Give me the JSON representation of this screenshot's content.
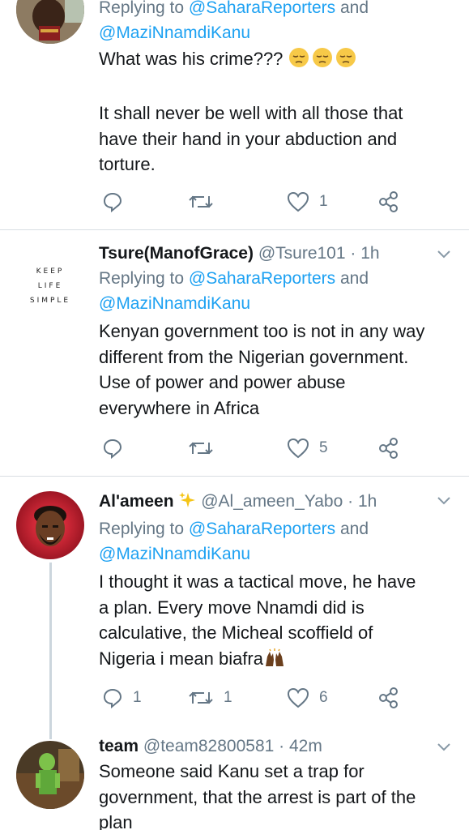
{
  "tweets": [
    {
      "reply_prefix": "Replying to",
      "reply_mention1": "@SaharaReporters",
      "reply_and": "and",
      "reply_mention2": "@MaziNnamdiKanu",
      "text_line1": "What was his crime???",
      "text_rest": "It shall never be well with all those that\nhave their hand in your abduction and\ntorture.",
      "emoji": "pensive-face x3",
      "actions": {
        "reply": "",
        "retweet": "",
        "like": "1"
      }
    },
    {
      "name": "Tsure(ManofGrace)",
      "handle": "@Tsure101",
      "sep": "·",
      "time": "1h",
      "reply_prefix": "Replying to",
      "reply_mention1": "@SaharaReporters",
      "reply_and": "and",
      "reply_mention2": "@MaziNnamdiKanu",
      "avatar_text": [
        "KEEP",
        "LIFE",
        "SIMPLE"
      ],
      "text": "Kenyan government too is not in any way\ndifferent from the Nigerian government.\nUse of power and power abuse\neverywhere in Africa",
      "actions": {
        "reply": "",
        "retweet": "",
        "like": "5"
      }
    },
    {
      "name": "Al'ameen",
      "name_icon": "sparkles-icon",
      "handle": "@Al_ameen_Yabo",
      "sep": "·",
      "time": "1h",
      "reply_prefix": "Replying to",
      "reply_mention1": "@SaharaReporters",
      "reply_and": "and",
      "reply_mention2": "@MaziNnamdiKanu",
      "text": "I thought it was a tactical move, he have\na plan. Every move Nnamdi did is\ncalculative, the Micheal scoffield of\nNigeria i mean biafra",
      "text_emoji": "raised-hands",
      "actions": {
        "reply": "1",
        "retweet": "1",
        "like": "6"
      }
    },
    {
      "name": "team",
      "handle": "@team82800581",
      "sep": "·",
      "time": "42m",
      "text": "Someone said Kanu set a trap for\ngovernment, that the arrest is part of the\nplan"
    }
  ],
  "colors": {
    "link": "#1da1f2",
    "muted": "#657786",
    "text": "#14171a",
    "divider": "#d8dee3"
  }
}
